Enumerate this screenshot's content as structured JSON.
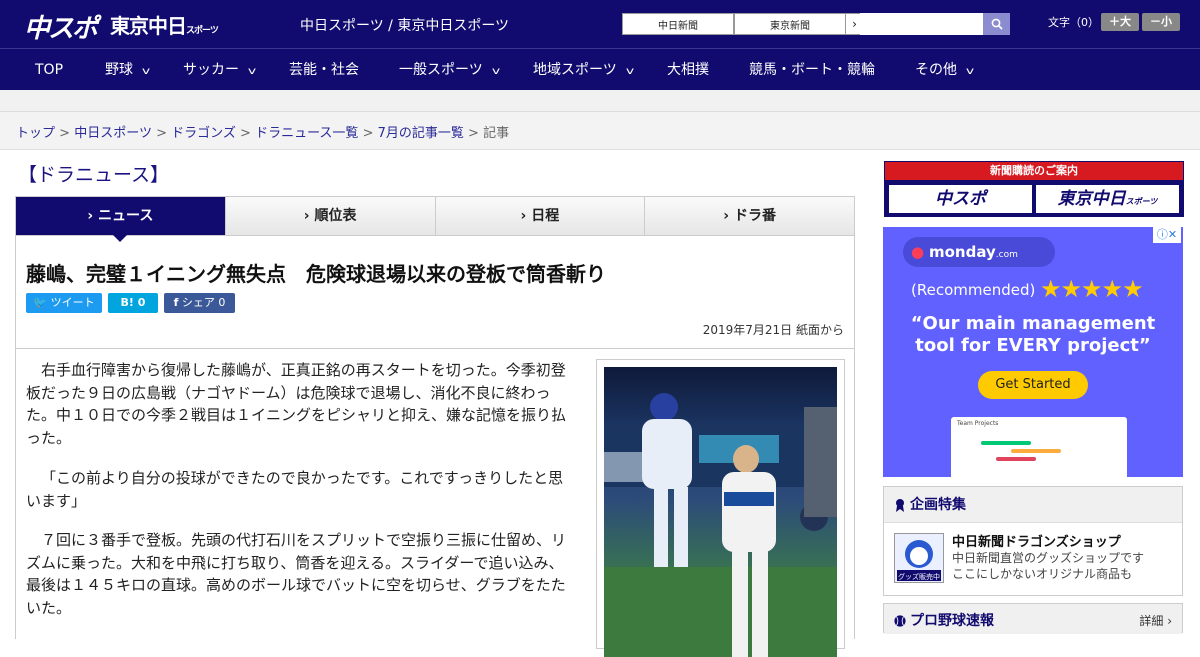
{
  "header": {
    "logo_chunichi_sports": "中スポ",
    "logo_tokyo": "東京中日",
    "logo_tokyo_small": "スポーツ",
    "site_names": "中日スポーツ / 東京中日スポーツ",
    "paper_link_1": "中日新聞",
    "paper_link_2": "東京新聞",
    "search_placeholder": "",
    "font_size_label": "文字（0）",
    "font_larger": "＋大",
    "font_smaller": "－小"
  },
  "nav": {
    "items": [
      {
        "label": "TOP"
      },
      {
        "label": "野球"
      },
      {
        "label": "サッカー"
      },
      {
        "label": "芸能・社会"
      },
      {
        "label": "一般スポーツ"
      },
      {
        "label": "地域スポーツ"
      },
      {
        "label": "大相撲"
      },
      {
        "label": "競馬・ボート・競輪"
      },
      {
        "label": "その他"
      }
    ]
  },
  "breadcrumb": {
    "items": [
      "トップ",
      "中日スポーツ",
      "ドラゴンズ",
      "ドラニュース一覧",
      "7月の記事一覧"
    ],
    "separator": ">",
    "current": "記事"
  },
  "section": {
    "title": "【ドラニュース】"
  },
  "tabs": [
    {
      "label": "ニュース",
      "active": true
    },
    {
      "label": "順位表",
      "active": false
    },
    {
      "label": "日程",
      "active": false
    },
    {
      "label": "ドラ番",
      "active": false
    }
  ],
  "article": {
    "headline": "藤嶋、完璧１イニング無失点　危険球退場以来の登板で筒香斬り",
    "share_tweet": "ツイート",
    "share_hatena": "B!",
    "share_hatena_count": "0",
    "share_fb": "シェア",
    "share_fb_count": "0",
    "date": "2019年7月21日 紙面から",
    "paragraphs": [
      "右手血行障害から復帰した藤嶋が、正真正銘の再スタートを切った。今季初登板だった９日の広島戦（ナゴヤドーム）は危険球で退場し、消化不良に終わった。中１０日での今季２戦目は１イニングをピシャリと抑え、嫌な記憶を振り払った。",
      "「この前より自分の投球ができたので良かったです。これですっきりしたと思います」",
      "７回に３番手で登板。先頭の代打石川をスプリットで空振り三振に仕留め、リズムに乗った。大和を中飛に打ち取り、筒香を迎える。スライダーで追い込み、最後は１４５キロの直球。高めのボール球でバットに空を切らせ、グラブをたたいた。"
    ]
  },
  "sidebar": {
    "subscription_label": "新聞購読のご案内",
    "sub_logo_1": "中スポ",
    "sub_logo_2": "東京中日",
    "sub_logo_2_small": "スポーツ",
    "ad": {
      "brand": "monday",
      "brand_suffix": ".com",
      "recommended": "(Recommended)",
      "stars": "★★★★★",
      "quote": "“Our main management tool for EVERY project”",
      "cta": "Get Started",
      "mock_title": "Team Projects"
    },
    "feature": {
      "title": "企画特集",
      "shop_title": "中日新聞ドラゴンズショップ",
      "shop_desc_1": "中日新聞直営のグッズショップです",
      "shop_desc_2": "ここにしかないオリジナル商品も",
      "shop_badge": "グッズ販売中"
    },
    "scores": {
      "title": "プロ野球速報",
      "more": "詳細 ›"
    }
  },
  "colors": {
    "brand_navy": "#120b6f",
    "accent_red": "#d71920",
    "monday_purple": "#6161ff",
    "cta_yellow": "#ffcb00",
    "twitter": "#1d9bf0",
    "hatena": "#00a4de",
    "facebook": "#3b5998"
  }
}
